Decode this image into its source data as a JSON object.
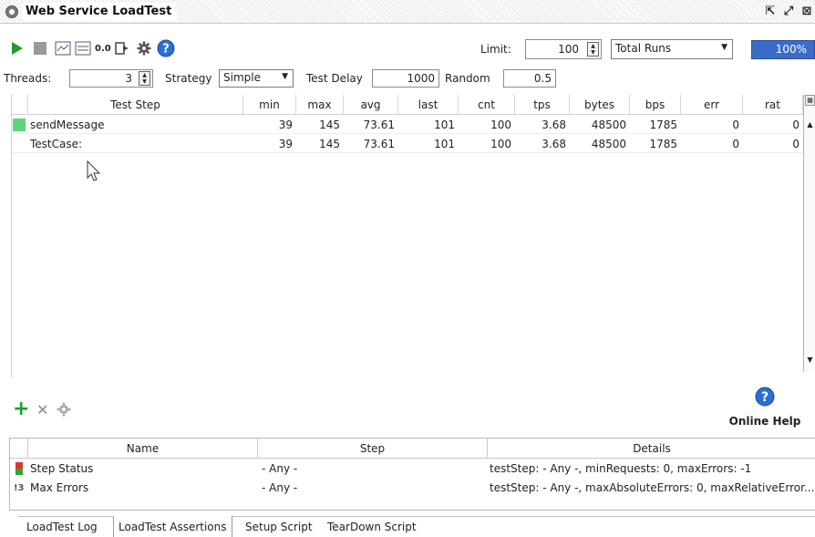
{
  "window": {
    "title": "Web Service LoadTest"
  },
  "toolbar": {
    "limit_label": "Limit:",
    "limit_value": "100",
    "limit_type": "Total Runs",
    "progress_label": "100%",
    "progress_value": 100,
    "stats_interval_label": "0.0"
  },
  "params": {
    "threads_label": "Threads:",
    "threads_value": "3",
    "strategy_label": "Strategy",
    "strategy_value": "Simple",
    "delay_label": "Test Delay",
    "delay_value": "1000",
    "random_label": "Random",
    "random_value": "0.5"
  },
  "stats": {
    "headers": [
      "Test Step",
      "min",
      "max",
      "avg",
      "last",
      "cnt",
      "tps",
      "bytes",
      "bps",
      "err",
      "rat"
    ],
    "rows": [
      {
        "name": "sendMessage",
        "min": "39",
        "max": "145",
        "avg": "73.61",
        "last": "101",
        "cnt": "100",
        "tps": "3.68",
        "bytes": "48500",
        "bps": "1785",
        "err": "0",
        "rat": "0"
      },
      {
        "name": "TestCase:",
        "min": "39",
        "max": "145",
        "avg": "73.61",
        "last": "101",
        "cnt": "100",
        "tps": "3.68",
        "bytes": "48500",
        "bps": "1785",
        "err": "0",
        "rat": "0"
      }
    ]
  },
  "help": {
    "label": "Online Help"
  },
  "assertions": {
    "headers": [
      "Name",
      "Step",
      "Details"
    ],
    "rows": [
      {
        "name": "Step Status",
        "step": "- Any -",
        "details": "testStep: - Any -, minRequests: 0, maxErrors: -1"
      },
      {
        "name": "Max Errors",
        "step": "- Any -",
        "details": "testStep: - Any -, maxAbsoluteErrors: 0, maxRelativeError..."
      }
    ]
  },
  "tabs": [
    "LoadTest Log",
    "LoadTest Assertions",
    "Setup Script",
    "TearDown Script"
  ],
  "colors": {
    "accent": "#3b6cc7",
    "run_green": "#1f9d2b",
    "status_green": "#5fd47b",
    "help_blue": "#2a6fd6"
  }
}
